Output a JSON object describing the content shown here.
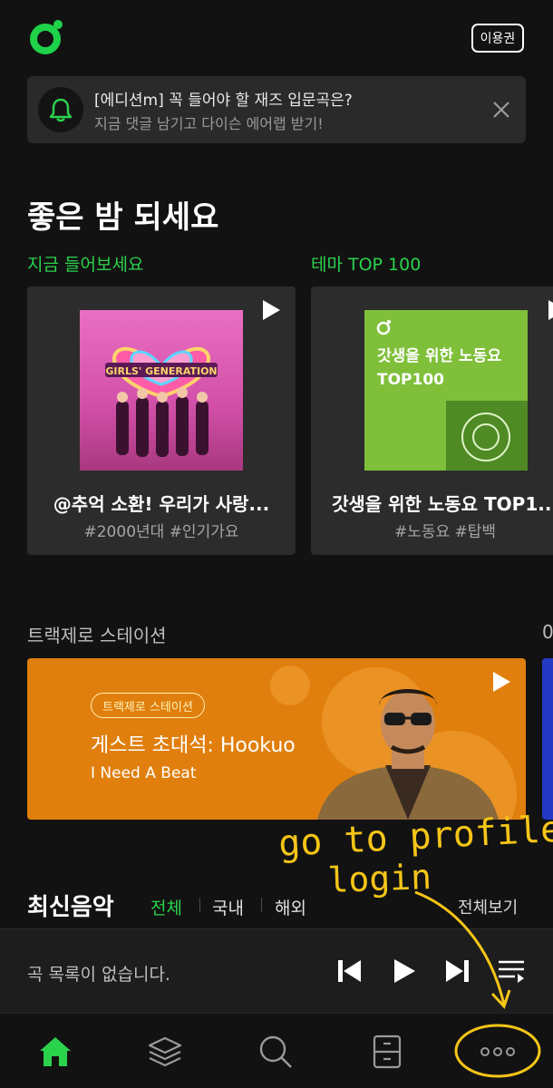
{
  "header": {
    "pass_label": "이용권"
  },
  "notice": {
    "line1": "[에디션m] 꼭 들어야 할 재즈 입문곡은?",
    "line2": "지금 댓글 남기고 다이슨 에어랩 받기!"
  },
  "greeting": "좋은 밤 되세요",
  "sections": {
    "now_listen": "지금 들어보세요",
    "theme_top": "테마 TOP 100"
  },
  "cards": [
    {
      "title": "@추억 소환! 우리가 사랑...",
      "tags": "#2000년대 #인기가요",
      "art_text": "GIRLS' GENERATION"
    },
    {
      "title": "갓생을 위한 노동요 TOP1...",
      "tags": "#노동요 #탑백",
      "art_text_line1": "갓생을 위한 노동요",
      "art_text_line2": "TOP100"
    }
  ],
  "track_zero": {
    "label": "트랙제로 스테이션",
    "next_label": "0",
    "banner": {
      "chip": "트랙제로 스테이션",
      "title": "게스트 초대석: Hookuo",
      "subtitle": "I Need A Beat"
    }
  },
  "annotation": {
    "line1": "go to profile",
    "line2": "login"
  },
  "latest": {
    "title": "최신음악",
    "tabs": [
      "전체",
      "국내",
      "해외"
    ],
    "see_all": "전체보기"
  },
  "player": {
    "empty_text": "곡 목록이 없습니다."
  },
  "nav": {
    "icons": [
      "home-icon",
      "layers-icon",
      "search-icon",
      "library-icon",
      "more-icon"
    ]
  },
  "colors": {
    "accent": "#2bd34d",
    "background": "#121212",
    "card": "#2c2c2c",
    "banner": "#e07f0d",
    "annotation": "#f5c518"
  }
}
